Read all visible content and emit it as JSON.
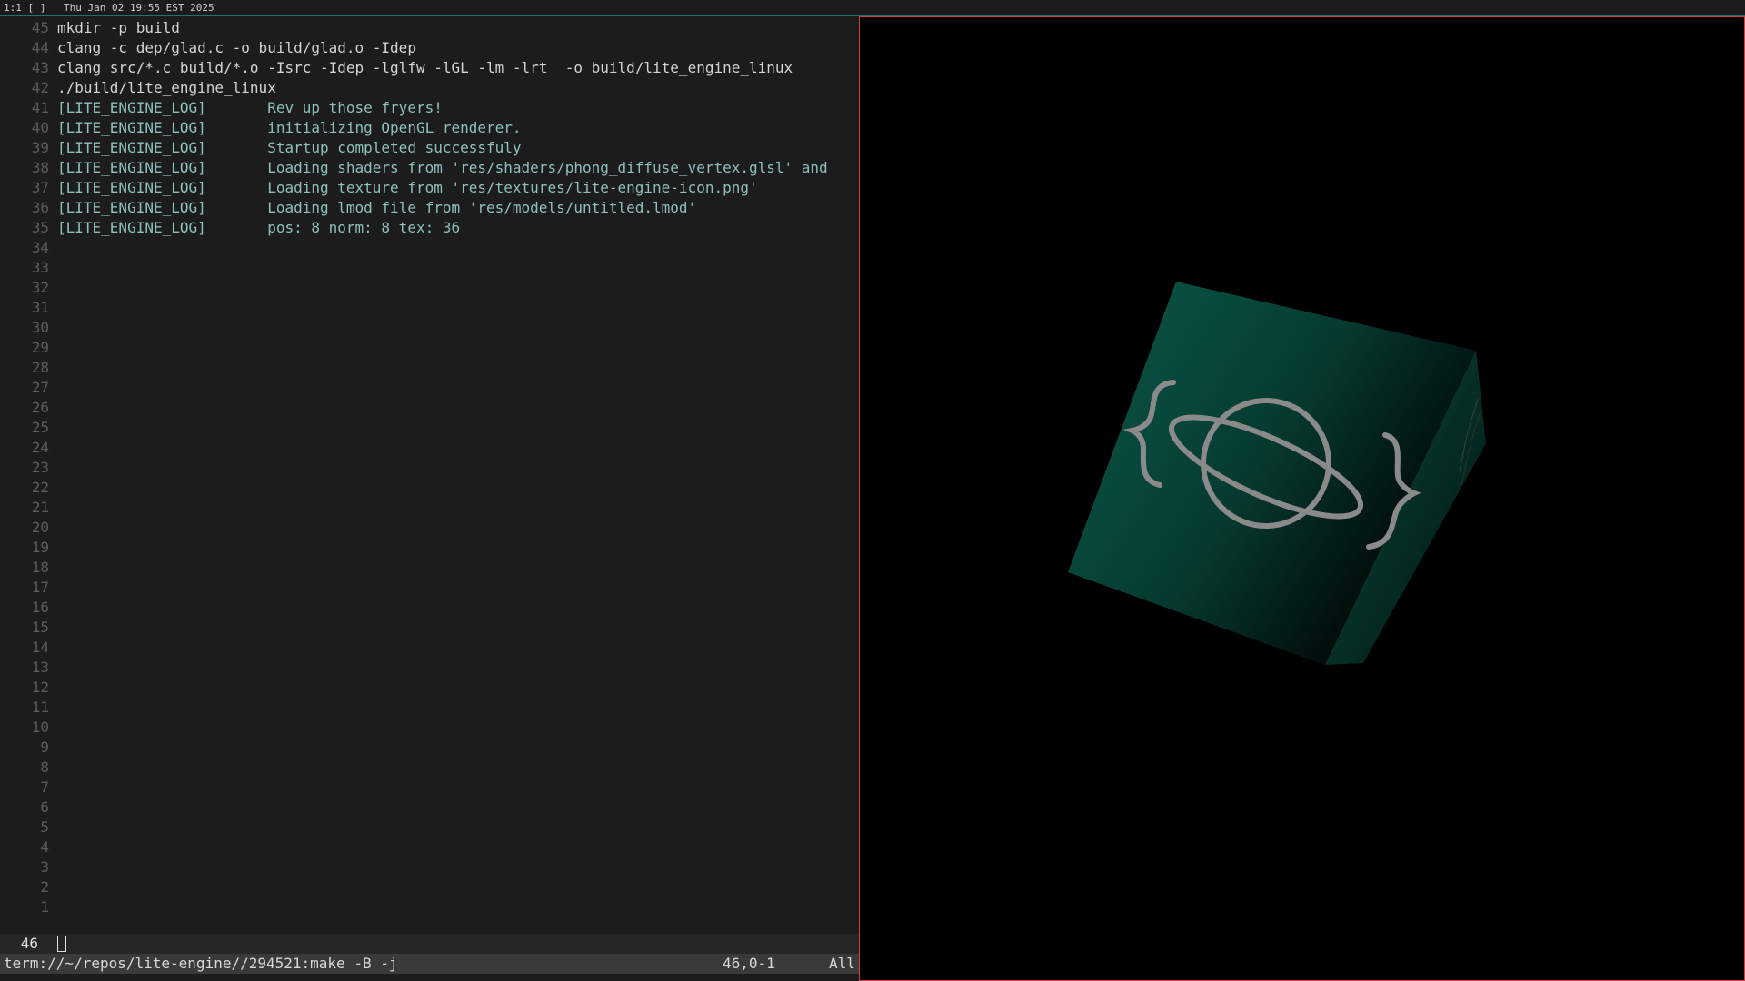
{
  "topbar": {
    "workspace": "1:1 [ ]",
    "datetime": "Thu Jan 02 19:55 EST 2025"
  },
  "terminal": {
    "lines": [
      {
        "num": "45",
        "text": "mkdir -p build",
        "kind": "cmd"
      },
      {
        "num": "44",
        "text": "clang -c dep/glad.c -o build/glad.o -Idep",
        "kind": "cmd"
      },
      {
        "num": "43",
        "text": "clang src/*.c build/*.o -Isrc -Idep -lglfw -lGL -lm -lrt  -o build/lite_engine_linux",
        "kind": "cmd"
      },
      {
        "num": "42",
        "text": "./build/lite_engine_linux",
        "kind": "cmd"
      },
      {
        "num": "41",
        "text": "[LITE_ENGINE_LOG]       Rev up those fryers!",
        "kind": "log"
      },
      {
        "num": "40",
        "text": "[LITE_ENGINE_LOG]       initializing OpenGL renderer.",
        "kind": "log"
      },
      {
        "num": "39",
        "text": "[LITE_ENGINE_LOG]       Startup completed successfuly",
        "kind": "log"
      },
      {
        "num": "38",
        "text": "[LITE_ENGINE_LOG]       Loading shaders from 'res/shaders/phong_diffuse_vertex.glsl' and",
        "kind": "log"
      },
      {
        "num": "37",
        "text": "[LITE_ENGINE_LOG]       Loading texture from 'res/textures/lite-engine-icon.png'",
        "kind": "log"
      },
      {
        "num": "36",
        "text": "[LITE_ENGINE_LOG]       Loading lmod file from 'res/models/untitled.lmod'",
        "kind": "log"
      },
      {
        "num": "35",
        "text": "[LITE_ENGINE_LOG]       pos: 8 norm: 8 tex: 36",
        "kind": "log"
      },
      {
        "num": "34",
        "text": "",
        "kind": "empty"
      },
      {
        "num": "33",
        "text": "",
        "kind": "empty"
      },
      {
        "num": "32",
        "text": "",
        "kind": "empty"
      },
      {
        "num": "31",
        "text": "",
        "kind": "empty"
      },
      {
        "num": "30",
        "text": "",
        "kind": "empty"
      },
      {
        "num": "29",
        "text": "",
        "kind": "empty"
      },
      {
        "num": "28",
        "text": "",
        "kind": "empty"
      },
      {
        "num": "27",
        "text": "",
        "kind": "empty"
      },
      {
        "num": "26",
        "text": "",
        "kind": "empty"
      },
      {
        "num": "25",
        "text": "",
        "kind": "empty"
      },
      {
        "num": "24",
        "text": "",
        "kind": "empty"
      },
      {
        "num": "23",
        "text": "",
        "kind": "empty"
      },
      {
        "num": "22",
        "text": "",
        "kind": "empty"
      },
      {
        "num": "21",
        "text": "",
        "kind": "empty"
      },
      {
        "num": "20",
        "text": "",
        "kind": "empty"
      },
      {
        "num": "19",
        "text": "",
        "kind": "empty"
      },
      {
        "num": "18",
        "text": "",
        "kind": "empty"
      },
      {
        "num": "17",
        "text": "",
        "kind": "empty"
      },
      {
        "num": "16",
        "text": "",
        "kind": "empty"
      },
      {
        "num": "15",
        "text": "",
        "kind": "empty"
      },
      {
        "num": "14",
        "text": "",
        "kind": "empty"
      },
      {
        "num": "13",
        "text": "",
        "kind": "empty"
      },
      {
        "num": "12",
        "text": "",
        "kind": "empty"
      },
      {
        "num": "11",
        "text": "",
        "kind": "empty"
      },
      {
        "num": "10",
        "text": "",
        "kind": "empty"
      },
      {
        "num": "9",
        "text": "",
        "kind": "empty"
      },
      {
        "num": "8",
        "text": "",
        "kind": "empty"
      },
      {
        "num": "7",
        "text": "",
        "kind": "empty"
      },
      {
        "num": "6",
        "text": "",
        "kind": "empty"
      },
      {
        "num": "5",
        "text": "",
        "kind": "empty"
      },
      {
        "num": "4",
        "text": "",
        "kind": "empty"
      },
      {
        "num": "3",
        "text": "",
        "kind": "empty"
      },
      {
        "num": "2",
        "text": "",
        "kind": "empty"
      },
      {
        "num": "1",
        "text": "",
        "kind": "empty"
      }
    ],
    "current_line_number": "46"
  },
  "statusline": {
    "path": "term://~/repos/lite-engine//294521:make -B -j",
    "position": "46,0-1",
    "scroll": "All"
  },
  "viewport": {
    "cube_color": "#0a5a4a",
    "logo_color": "#8a8a8a",
    "border_color": "#cc4040"
  }
}
